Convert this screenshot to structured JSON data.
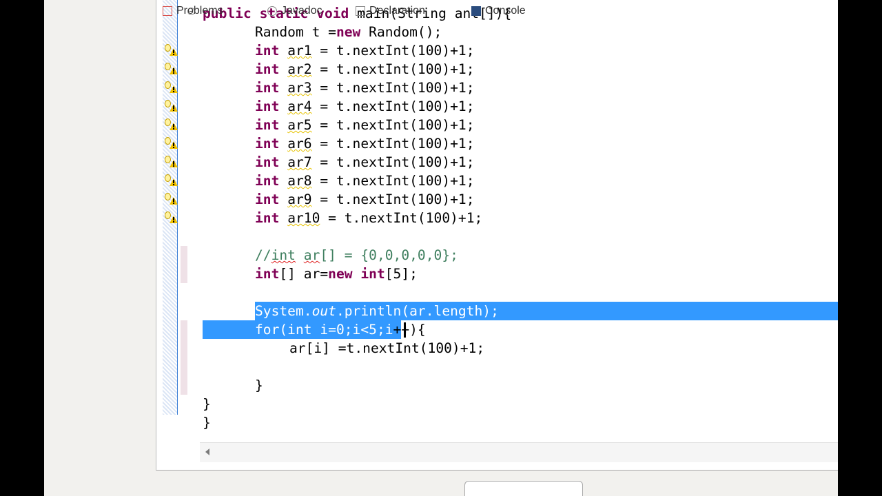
{
  "editor": {
    "lines": [
      "public static void main(String ant[]){",
      "Random t =new Random();",
      "int ar1 = t.nextInt(100)+1;",
      "int ar2 = t.nextInt(100)+1;",
      "int ar3 = t.nextInt(100)+1;",
      "int ar4 = t.nextInt(100)+1;",
      "int ar5 = t.nextInt(100)+1;",
      "int ar6 = t.nextInt(100)+1;",
      "int ar7 = t.nextInt(100)+1;",
      "int ar8 = t.nextInt(100)+1;",
      "int ar9 = t.nextInt(100)+1;",
      "int ar10 = t.nextInt(100)+1;",
      "",
      "//int ar[] = {0,0,0,0,0};",
      "int[] ar=new int[5];",
      "",
      "System.out.println(ar.length);",
      "for(int i=0;i<5;i++){",
      "ar[i] =t.nextInt(100)+1;",
      "",
      "}",
      "}",
      "}"
    ],
    "warning_icon": "warning-lightbulb-icon",
    "selection_color": "#3399ff",
    "keyword_color": "#7f0055",
    "comment_color": "#3f7f5f"
  },
  "bottom_tabs": [
    {
      "label": "Problems",
      "icon": "problems-icon"
    },
    {
      "label": "Javadoc",
      "icon": "javadoc-icon"
    },
    {
      "label": "Declaration",
      "icon": "declaration-icon"
    },
    {
      "label": "Console",
      "icon": "console-icon",
      "active": true
    }
  ]
}
